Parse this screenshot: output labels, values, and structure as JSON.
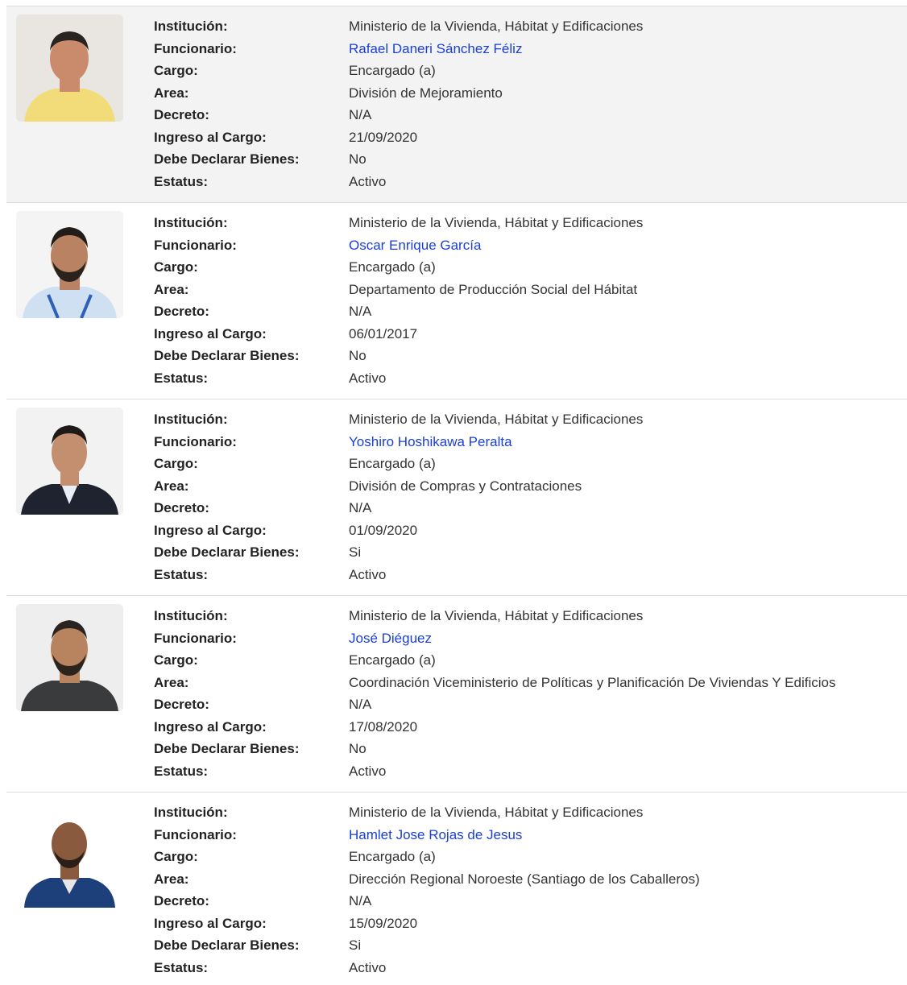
{
  "labels": {
    "institucion": "Institución:",
    "funcionario": "Funcionario:",
    "cargo": "Cargo:",
    "area": "Area:",
    "decreto": "Decreto:",
    "ingreso": "Ingreso al Cargo:",
    "declarar": "Debe Declarar Bienes:",
    "estatus": "Estatus:"
  },
  "colors": {
    "link": "#1a3fd6",
    "highlight_row": "#f3f3f3",
    "divider": "#dddddd"
  },
  "records": [
    {
      "photo_icon": "person-photo",
      "institucion": "Ministerio de la Vivienda, Hábitat y Edificaciones",
      "funcionario": "Rafael Daneri Sánchez Féliz",
      "cargo": "Encargado (a)",
      "area": "División de Mejoramiento",
      "decreto": "N/A",
      "ingreso": "21/09/2020",
      "declarar": "No",
      "estatus": "Activo"
    },
    {
      "photo_icon": "person-photo",
      "institucion": "Ministerio de la Vivienda, Hábitat y Edificaciones",
      "funcionario": "Oscar Enrique García",
      "cargo": "Encargado (a)",
      "area": "Departamento de Producción Social del Hábitat",
      "decreto": "N/A",
      "ingreso": "06/01/2017",
      "declarar": "No",
      "estatus": "Activo"
    },
    {
      "photo_icon": "person-photo",
      "institucion": "Ministerio de la Vivienda, Hábitat y Edificaciones",
      "funcionario": "Yoshiro Hoshikawa Peralta",
      "cargo": "Encargado (a)",
      "area": "División de Compras y Contrataciones",
      "decreto": "N/A",
      "ingreso": "01/09/2020",
      "declarar": "Si",
      "estatus": "Activo"
    },
    {
      "photo_icon": "person-photo",
      "institucion": "Ministerio de la Vivienda, Hábitat y Edificaciones",
      "funcionario": "José Diéguez",
      "cargo": "Encargado (a)",
      "area": "Coordinación Viceministerio de Políticas y Planificación De Viviendas Y Edificios",
      "decreto": "N/A",
      "ingreso": "17/08/2020",
      "declarar": "No",
      "estatus": "Activo"
    },
    {
      "photo_icon": "person-photo",
      "institucion": "Ministerio de la Vivienda, Hábitat y Edificaciones",
      "funcionario": "Hamlet Jose Rojas de Jesus",
      "cargo": "Encargado (a)",
      "area": "Dirección Regional Noroeste (Santiago de los Caballeros)",
      "decreto": "N/A",
      "ingreso": "15/09/2020",
      "declarar": "Si",
      "estatus": "Activo"
    }
  ]
}
